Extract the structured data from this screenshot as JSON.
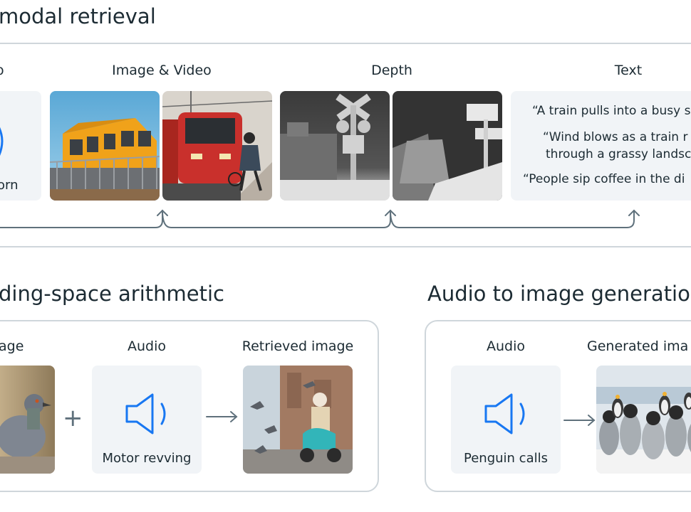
{
  "top": {
    "title": "modal retrieval",
    "labels": {
      "audio_partial": "o",
      "image_video": "Image & Video",
      "depth": "Depth",
      "text": "Text"
    },
    "audio_caption_partial": "orn",
    "text_quotes": [
      "“A train pulls into a busy s",
      "“Wind blows as a train r",
      "through a grassy landsc",
      "“People sip coffee in the di"
    ]
  },
  "bottom_left": {
    "title": "ding-space arithmetic",
    "labels": {
      "image_partial": "age",
      "audio": "Audio",
      "retrieved": "Retrieved image"
    },
    "plus": "+",
    "audio_caption": "Motor revving"
  },
  "bottom_right": {
    "title": "Audio to image generatio",
    "labels": {
      "audio": "Audio",
      "generated_partial": "Generated ima"
    },
    "audio_caption": "Penguin calls"
  },
  "colors": {
    "accent": "#1877f2",
    "rule": "#cfd6db",
    "tile": "#f1f4f7",
    "arrow": "#5f717c"
  }
}
